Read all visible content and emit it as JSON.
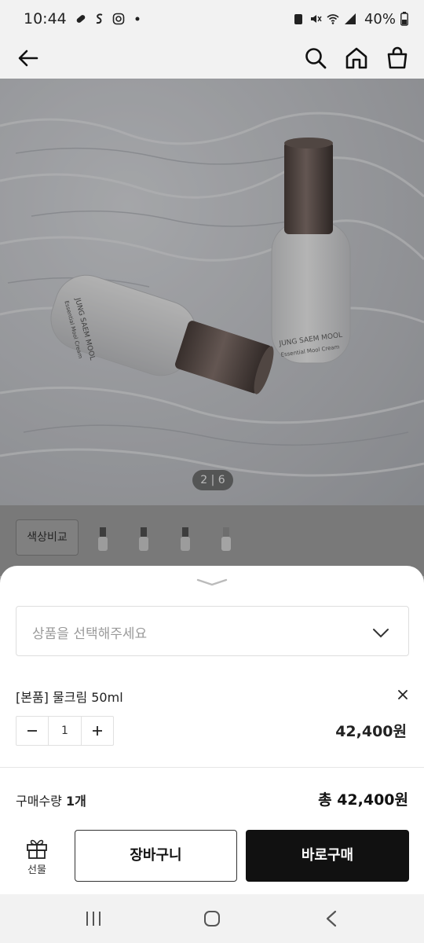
{
  "status_bar": {
    "time": "10:44",
    "battery": "40%",
    "icons_left": [
      "pill-icon",
      "s-icon",
      "instagram-icon",
      "dot-icon"
    ],
    "icons_right": [
      "battery-saver-icon",
      "mute-icon",
      "wifi-icon",
      "signal-icon",
      "battery-icon"
    ]
  },
  "header": {
    "icons": [
      "back-arrow-icon",
      "search-icon",
      "home-icon",
      "shopping-bag-icon"
    ]
  },
  "gallery": {
    "pager": "2 | 6",
    "bottle_brand": "JUNG SAEM MOOL",
    "bottle_product": "Essential Mool Cream"
  },
  "compare": {
    "button_label": "색상비교"
  },
  "sheet": {
    "select_placeholder": "상품을 선택해주세요",
    "option_name": "[본품] 물크림 50ml",
    "quantity": "1",
    "option_price": "42,400원",
    "qty_label_prefix": "구매수량",
    "qty_label_value": "1개",
    "total_label": "총 42,400원",
    "gift_label": "선물",
    "cart_label": "장바구니",
    "buy_label": "바로구매"
  },
  "colors": {
    "primary_button": "#111111",
    "sheet_bg": "#ffffff"
  }
}
